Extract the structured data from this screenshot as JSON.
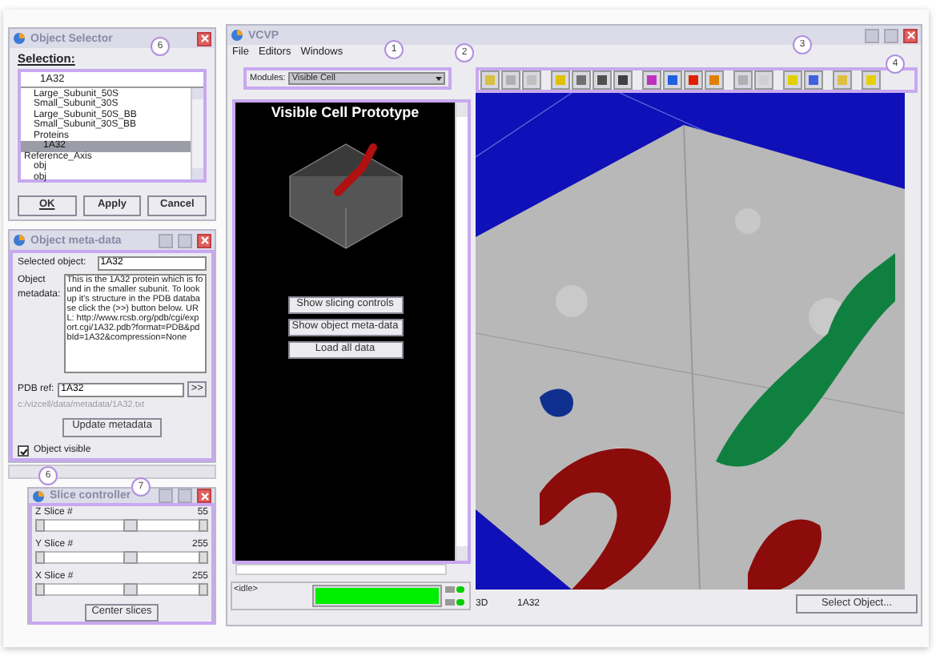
{
  "selector": {
    "title": "Object Selector",
    "label": "Selection:",
    "value": "1A32",
    "items": [
      {
        "label": "Large_Subunit_50S",
        "selected": false
      },
      {
        "label": "Small_Subunit_30S",
        "selected": false
      },
      {
        "label": "Large_Subunit_50S_BB",
        "selected": false
      },
      {
        "label": "Small_Subunit_30S_BB",
        "selected": false
      },
      {
        "label": "Proteins",
        "selected": false,
        "children": [
          {
            "label": "1A32",
            "selected": true
          }
        ]
      },
      {
        "label": "Reference_Axis",
        "selected": false,
        "children": [
          {
            "label": "obj",
            "selected": false
          },
          {
            "label": "obj",
            "selected": false
          }
        ]
      }
    ],
    "buttons": [
      "OK",
      "Apply",
      "Cancel"
    ]
  },
  "metadata": {
    "title": "Object meta-data",
    "selected_label": "Selected object:",
    "selected_value": "1A32",
    "metadata_label": "Object metadata:",
    "metadata_value": "This is the 1A32 protein which is found in the smaller subunit. To look up it's structure in the PDB database click the (>>) button below. URL: http://www.rcsb.org/pdb/cgi/export.cgi/1A32.pdb?format=PDB&pdbId=1A32&compression=None",
    "pdb_label": "PDB ref:",
    "pdb_value": "1A32",
    "go_button": ">>",
    "path": "c:/vizcell/data/metadata/1A32.txt",
    "update_button": "Update metadata",
    "visible_label": "Object visible",
    "visible_checked": true
  },
  "slices": {
    "title": "Slice controller",
    "sliders": [
      {
        "label": "Z Slice #",
        "reading": "55",
        "level": 0.55
      },
      {
        "label": "Y Slice #",
        "reading": "255",
        "level": 0.55
      },
      {
        "label": "X Slice #",
        "reading": "255",
        "level": 0.55
      }
    ],
    "button": "Center slices"
  },
  "main": {
    "title": "VCVP",
    "menu": [
      "File",
      "Editors",
      "Windows"
    ],
    "modules_label": "Modules:",
    "modules_value": "Visible Cell",
    "panel_title": "Visible Cell Prototype",
    "panel_buttons": [
      "Show slicing controls",
      "Show object meta-data",
      "Load all data"
    ],
    "status": "<idle>",
    "progress": {
      "level": 1
    },
    "view_mode": "3D",
    "view_object": "1A32",
    "select_button": "Select Object..."
  },
  "callouts": [
    "1",
    "2",
    "3",
    "4",
    "6",
    "6",
    "7"
  ]
}
